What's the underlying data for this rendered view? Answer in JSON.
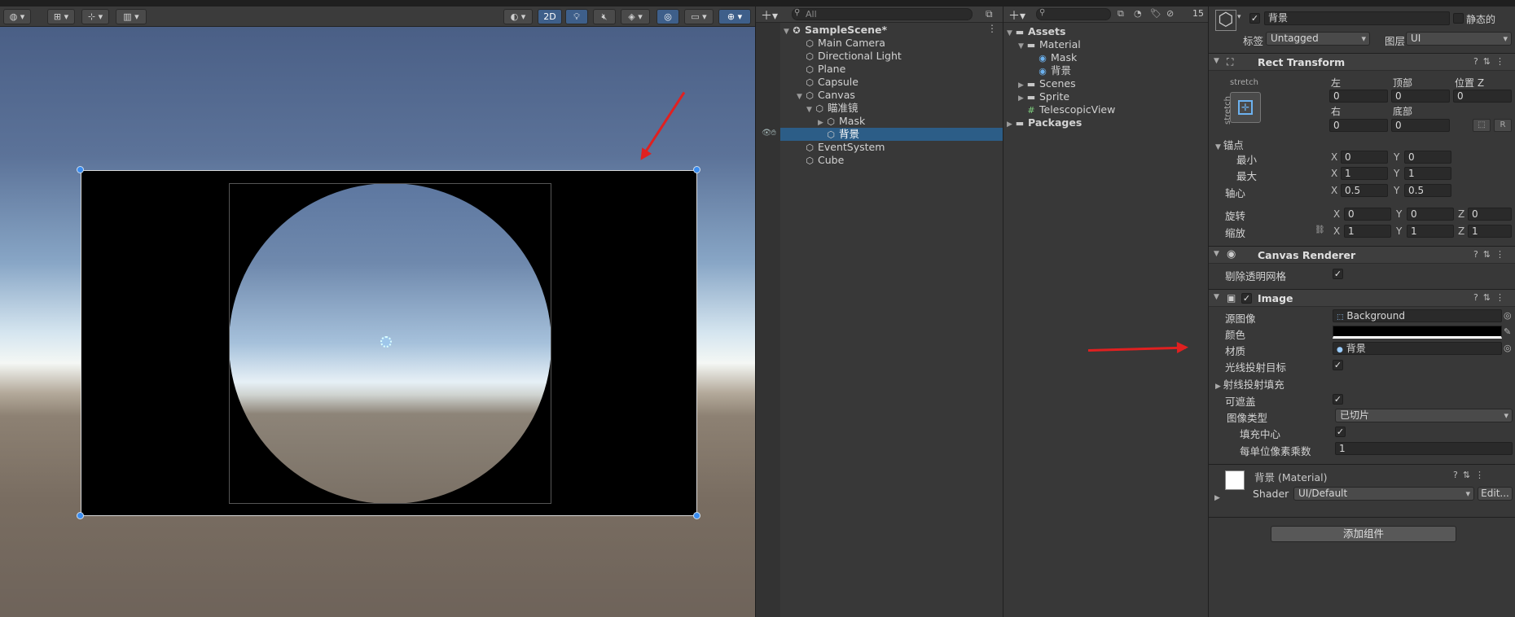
{
  "scene_toolbar": {
    "btn_2d": "2D"
  },
  "hierarchy": {
    "items": [
      {
        "label": "SampleScene*",
        "depth": 0,
        "kind": "scene",
        "bold": true
      },
      {
        "label": "Main Camera",
        "depth": 1
      },
      {
        "label": "Directional Light",
        "depth": 1
      },
      {
        "label": "Plane",
        "depth": 1
      },
      {
        "label": "Capsule",
        "depth": 1
      },
      {
        "label": "Canvas",
        "depth": 1
      },
      {
        "label": "瞄准镜",
        "depth": 2
      },
      {
        "label": "Mask",
        "depth": 3
      },
      {
        "label": "背景",
        "depth": 3,
        "selected": true
      },
      {
        "label": "EventSystem",
        "depth": 1
      },
      {
        "label": "Cube",
        "depth": 1
      }
    ],
    "search_placeholder": "All"
  },
  "project": {
    "visible_count": "15",
    "items": [
      {
        "label": "Assets",
        "depth": 0,
        "icon": "folder-icon",
        "bold": true
      },
      {
        "label": "Material",
        "depth": 1,
        "icon": "folder-icon"
      },
      {
        "label": "Mask",
        "depth": 2,
        "icon": "material-icon"
      },
      {
        "label": "背景",
        "depth": 2,
        "icon": "material-icon"
      },
      {
        "label": "Scenes",
        "depth": 1,
        "icon": "folder-icon"
      },
      {
        "label": "Sprite",
        "depth": 1,
        "icon": "folder-icon"
      },
      {
        "label": "TelescopicView",
        "depth": 1,
        "icon": "script-icon"
      },
      {
        "label": "Packages",
        "depth": 0,
        "icon": "folder-icon",
        "bold": true
      }
    ]
  },
  "inspector": {
    "object_name": "背景",
    "static_label": "静态的",
    "tag_label": "标签",
    "tag_value": "Untagged",
    "layer_label": "图层",
    "layer_value": "UI",
    "rect_transform": {
      "title": "Rect Transform",
      "anchor_preset": "stretch",
      "left_label": "左",
      "left": "0",
      "top_label": "顶部",
      "top": "0",
      "posz_label": "位置 Z",
      "posz": "0",
      "right_label": "右",
      "right": "0",
      "bottom_label": "底部",
      "bottom": "0",
      "anchors_label": "锚点",
      "min_label": "最小",
      "min_x": "0",
      "min_y": "0",
      "max_label": "最大",
      "max_x": "1",
      "max_y": "1",
      "pivot_label": "轴心",
      "pivot_x": "0.5",
      "pivot_y": "0.5",
      "rotation_label": "旋转",
      "rot_x": "0",
      "rot_y": "0",
      "rot_z": "0",
      "scale_label": "缩放",
      "scale_x": "1",
      "scale_y": "1",
      "scale_z": "1",
      "r_btn": "R"
    },
    "canvas_renderer": {
      "title": "Canvas Renderer",
      "cull_label": "剔除透明网格"
    },
    "image": {
      "title": "Image",
      "source_label": "源图像",
      "source_value": "Background",
      "color_label": "颜色",
      "material_label": "材质",
      "material_value": "背景",
      "raycast_label": "光线投射目标",
      "padding_label": "射线投射填充",
      "maskable_label": "可遮盖",
      "type_label": "图像类型",
      "type_value": "已切片",
      "fill_center_label": "填充中心",
      "ppu_label": "每单位像素乘数",
      "ppu_value": "1"
    },
    "material_block": {
      "title": "背景 (Material)",
      "shader_label": "Shader",
      "shader_value": "UI/Default",
      "edit_label": "Edit..."
    },
    "add_component": "添加组件"
  },
  "colors": {
    "selection": "#2c5d87",
    "accent": "#3e5f8a",
    "annotation_arrow": "#e02020"
  }
}
